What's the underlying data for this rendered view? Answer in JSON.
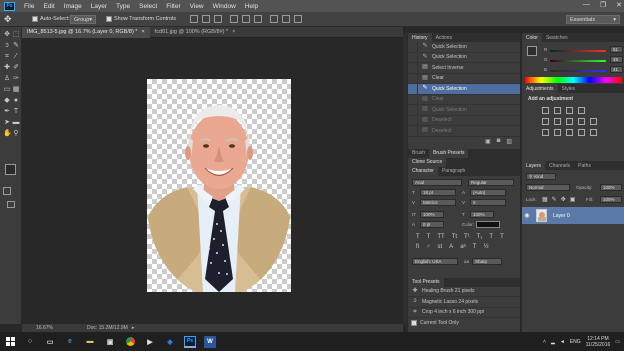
{
  "menubar": {
    "app_icon": "Ps",
    "items": [
      "File",
      "Edit",
      "Image",
      "Layer",
      "Type",
      "Select",
      "Filter",
      "View",
      "Window",
      "Help"
    ],
    "min": "—",
    "max": "❐",
    "close": "✕"
  },
  "options": {
    "auto_select_label": "Auto-Select:",
    "auto_select_value": "Group",
    "show_transform_label": "Show Transform Controls",
    "workspace": "Essentials"
  },
  "doc_tabs": [
    {
      "label": "IMG_8513-5.jpg @ 16.7% (Layer 0, RGB/8) *",
      "active": true
    },
    {
      "label": "fcd01.jpg @ 100% (RGB/8#) *",
      "active": false
    }
  ],
  "status": {
    "zoom": "16.67%",
    "doc": "Doc: 15.2M/12.9M"
  },
  "history": {
    "tabs": [
      "History",
      "Actions"
    ],
    "items": [
      {
        "label": "Quick Selection",
        "state": "normal"
      },
      {
        "label": "Quick Selection",
        "state": "normal"
      },
      {
        "label": "Select Inverse",
        "state": "normal"
      },
      {
        "label": "Clear",
        "state": "normal"
      },
      {
        "label": "Quick Selection",
        "state": "selected"
      },
      {
        "label": "Clear",
        "state": "dim"
      },
      {
        "label": "Quick Selection",
        "state": "dim"
      },
      {
        "label": "Deselect",
        "state": "dim"
      },
      {
        "label": "Deselect",
        "state": "dim"
      }
    ]
  },
  "brush": {
    "tabs": [
      "Brush",
      "Brush Presets"
    ],
    "clone_source": "Clone Source"
  },
  "character": {
    "tabs": [
      "Character",
      "Paragraph"
    ],
    "font": "Arial",
    "style": "Regular",
    "size": "18 pt",
    "leading": "(Auto)",
    "kerning": "Metrics",
    "tracking": "0",
    "v_scale": "100%",
    "h_scale": "100%",
    "baseline": "0 pt",
    "color_label": "Color:",
    "language": "English: USA",
    "aa_label": "aa",
    "aa": "Sharp"
  },
  "tool_presets": {
    "title": "Tool Presets",
    "items": [
      "Healing Brush 21 pixels",
      "Magnetic Lasso 24 pixels",
      "Crop 4 inch x 6 inch 300 ppi"
    ],
    "current_only": "Current Tool Only"
  },
  "color": {
    "tabs": [
      "Color",
      "Swatches"
    ],
    "r": "51",
    "g": "45",
    "b": "41",
    "r_label": "R",
    "g_label": "G",
    "b_label": "B"
  },
  "adjustments": {
    "tabs": [
      "Adjustments",
      "Styles"
    ],
    "title": "Add an adjustment"
  },
  "layers": {
    "tabs": [
      "Layers",
      "Channels",
      "Paths"
    ],
    "kind": "Kind",
    "blend": "Normal",
    "opacity_label": "Opacity:",
    "opacity": "100%",
    "lock_label": "Lock:",
    "fill_label": "Fill:",
    "fill": "100%",
    "layer_name": "Layer 0"
  },
  "taskbar": {
    "lang": "ENG",
    "time": "12:14 PM",
    "date": "11/25/2016"
  },
  "colors": {
    "selection": "#4d6e9e",
    "panel": "#3c3c3c",
    "accent": "#31a8ff"
  }
}
